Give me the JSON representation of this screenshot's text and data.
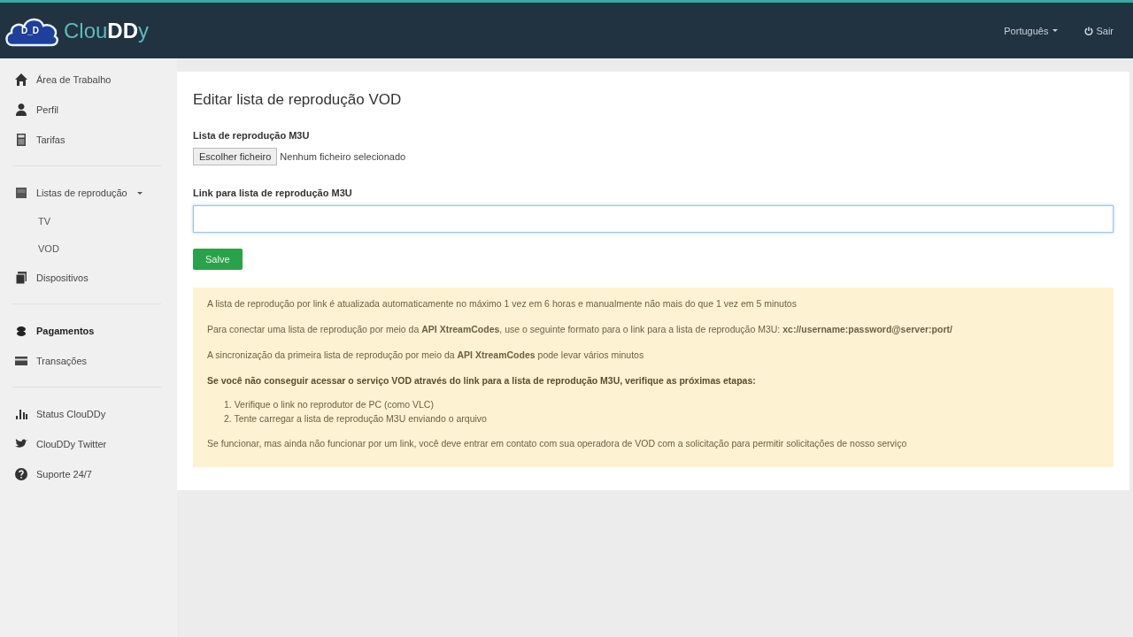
{
  "header": {
    "logo": {
      "cloud_text": "D_D",
      "parts": [
        {
          "text": "Clou",
          "kind": "light"
        },
        {
          "text": "DD",
          "kind": "strong"
        },
        {
          "text": "y",
          "kind": "light"
        }
      ]
    },
    "language": "Português",
    "logout": "Sair"
  },
  "sidebar": {
    "groups": [
      {
        "items": [
          {
            "label": "Área de Trabalho",
            "kind": "home",
            "selected": false
          },
          {
            "label": "Perfil",
            "kind": "user",
            "selected": false
          },
          {
            "label": "Tarifas",
            "kind": "calculator",
            "selected": false
          }
        ]
      },
      {
        "items": [
          {
            "label": "Listas de reprodução",
            "kind": "list",
            "selected": false,
            "expanded": true,
            "children": [
              {
                "label": "TV",
                "selected": false
              },
              {
                "label": "VOD",
                "selected": false
              }
            ]
          },
          {
            "label": "Dispositivos",
            "kind": "devices",
            "selected": false
          }
        ]
      },
      {
        "items": [
          {
            "label": "Pagamentos",
            "kind": "coins",
            "selected": true
          },
          {
            "label": "Transações",
            "kind": "card",
            "selected": false
          }
        ]
      },
      {
        "items": [
          {
            "label": "Status ClouDDy",
            "kind": "chart",
            "selected": false
          },
          {
            "label": "ClouDDy Twitter",
            "kind": "bird",
            "selected": false
          },
          {
            "label": "Suporte 24/7",
            "kind": "help",
            "selected": false
          }
        ]
      }
    ]
  },
  "form": {
    "title": "Editar lista de reprodução VOD",
    "file_label": "Lista de reprodução M3U",
    "file_button": "Escolher ficheiro",
    "file_status": "Nenhum ficheiro selecionado",
    "link_label": "Link para lista de reprodução M3U",
    "save_button": "Salve"
  },
  "notice": {
    "paragraphs": [
      {
        "kind": "text",
        "text": "A lista de reprodução por link é atualizada automaticamente no máximo 1 vez em 6 horas e manualmente não mais do que 1 vez em 5 minutos"
      },
      {
        "kind": "text",
        "text": "Para conectar uma lista de reprodução por meio da **API XtreamCodes**, use o seguinte formato para o link para a lista de reprodução M3U: **xc://username:password@server:port/**"
      },
      {
        "kind": "text",
        "text": "A sincronização da primeira lista de reprodução por meio da **API XtreamCodes** pode levar vários minutos"
      },
      {
        "kind": "heading",
        "text": "Se você não conseguir acessar o serviço VOD através do link para a lista de reprodução M3U, verifique as próximas etapas:"
      },
      {
        "kind": "list",
        "items": [
          {
            "num": "1.",
            "text": "Verifique o link no reprodutor de PC (como VLC)"
          },
          {
            "num": "2.",
            "text": "Tente carregar a lista de reprodução M3U enviando o arquivo"
          }
        ]
      },
      {
        "kind": "text",
        "text": "Se funcionar, mas ainda não funcionar por um link, você deve entrar em contato com sua operadora de VOD com a solicitação para permitir solicitações de nosso serviço"
      }
    ]
  }
}
